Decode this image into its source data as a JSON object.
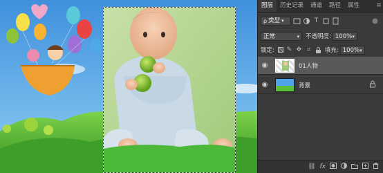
{
  "panel_tabs": [
    {
      "label": "图层",
      "active": true
    },
    {
      "label": "历史记录",
      "active": false
    },
    {
      "label": "通道",
      "active": false
    },
    {
      "label": "路径",
      "active": false
    },
    {
      "label": "属性",
      "active": false
    }
  ],
  "panel_menu_icon": "menu-icon",
  "filter": {
    "kind_label": "类型",
    "icons": [
      "image-filter-icon",
      "adjustment-filter-icon",
      "type-filter-icon",
      "shape-filter-icon",
      "smart-object-filter-icon"
    ]
  },
  "blend": {
    "mode": "正常",
    "opacity_label": "不透明度:",
    "opacity_value": "100%"
  },
  "lock": {
    "label": "锁定:",
    "icons": [
      "lock-transparent-icon",
      "lock-image-icon",
      "lock-position-icon",
      "lock-artboard-icon",
      "lock-all-icon"
    ],
    "fill_label": "填充:",
    "fill_value": "100%"
  },
  "layers": [
    {
      "name": "01人物",
      "visible": true,
      "selected": true,
      "locked": false
    },
    {
      "name": "背景",
      "visible": true,
      "selected": false,
      "locked": true
    }
  ],
  "bottom_icons": [
    "link-icon",
    "fx-icon",
    "mask-icon",
    "adjustment-icon",
    "group-icon",
    "new-layer-icon",
    "delete-icon"
  ],
  "bottom_labels": {
    "fx": "fx"
  },
  "colors": {
    "panel_bg": "#3a3a3a",
    "selected_layer": "#595959",
    "sky": "#5fa7e8",
    "grass": "#4cb83a"
  }
}
